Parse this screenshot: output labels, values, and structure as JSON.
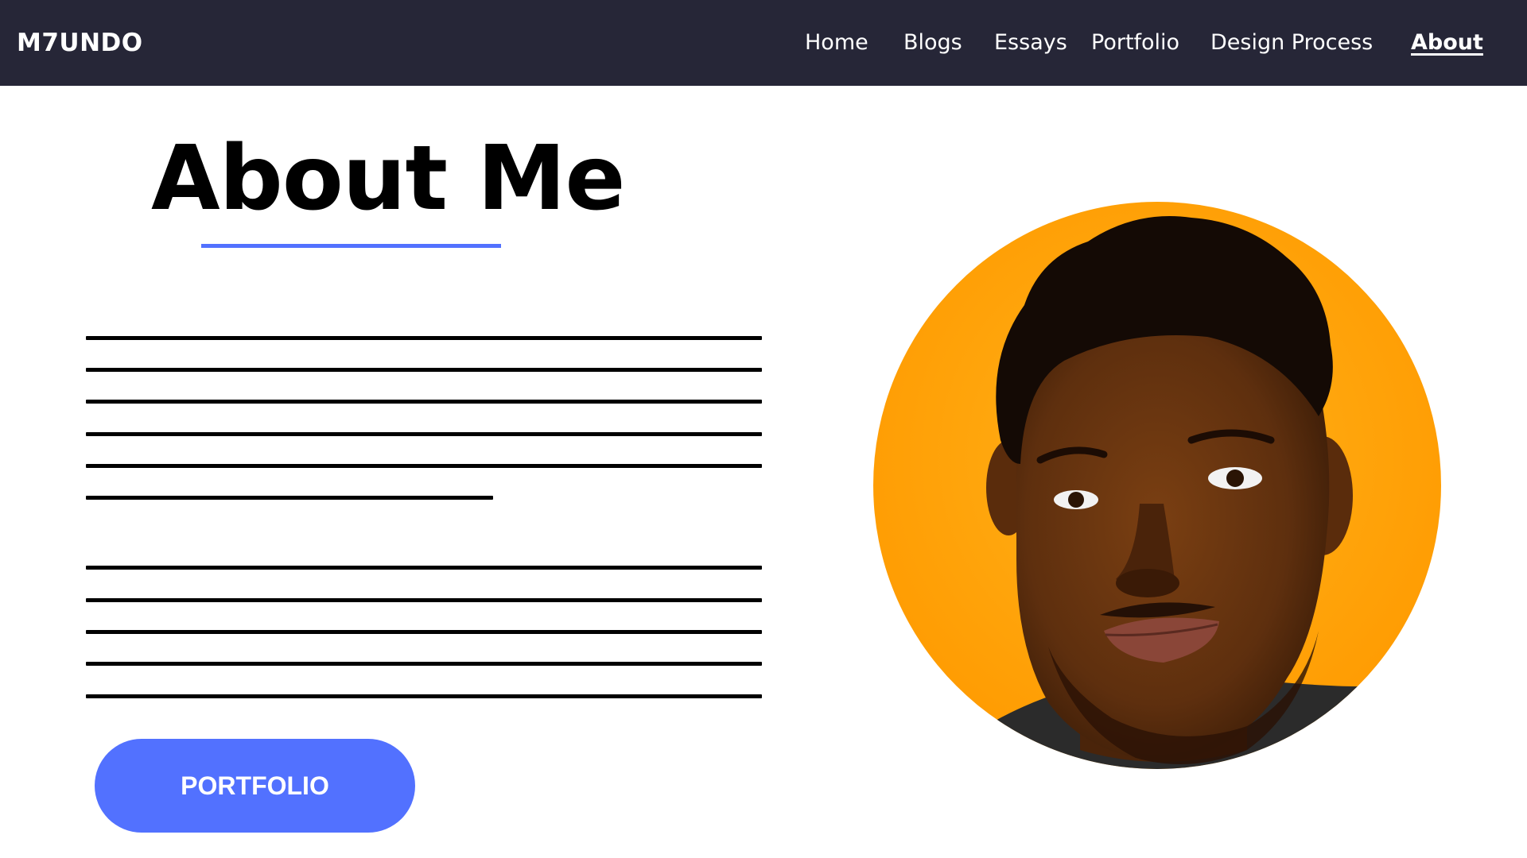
{
  "navbar": {
    "brand": "M7UNDO",
    "links": [
      {
        "label": "Home",
        "active": false
      },
      {
        "label": "Blogs",
        "active": false
      },
      {
        "label": "Essays",
        "active": false
      },
      {
        "label": "Portfolio",
        "active": false
      },
      {
        "label": "Design Process",
        "active": false
      },
      {
        "label": "About",
        "active": true
      }
    ]
  },
  "main": {
    "title": "About Me",
    "button_label": "PORTFOLIO",
    "paragraphs_placeholder_lines": [
      6,
      5
    ]
  },
  "avatar": {
    "icon": "portrait-illustration"
  },
  "colors": {
    "navbar_bg": "#262637",
    "accent": "#5271ff",
    "avatar_bg": "#ffa200",
    "text": "#000000"
  }
}
